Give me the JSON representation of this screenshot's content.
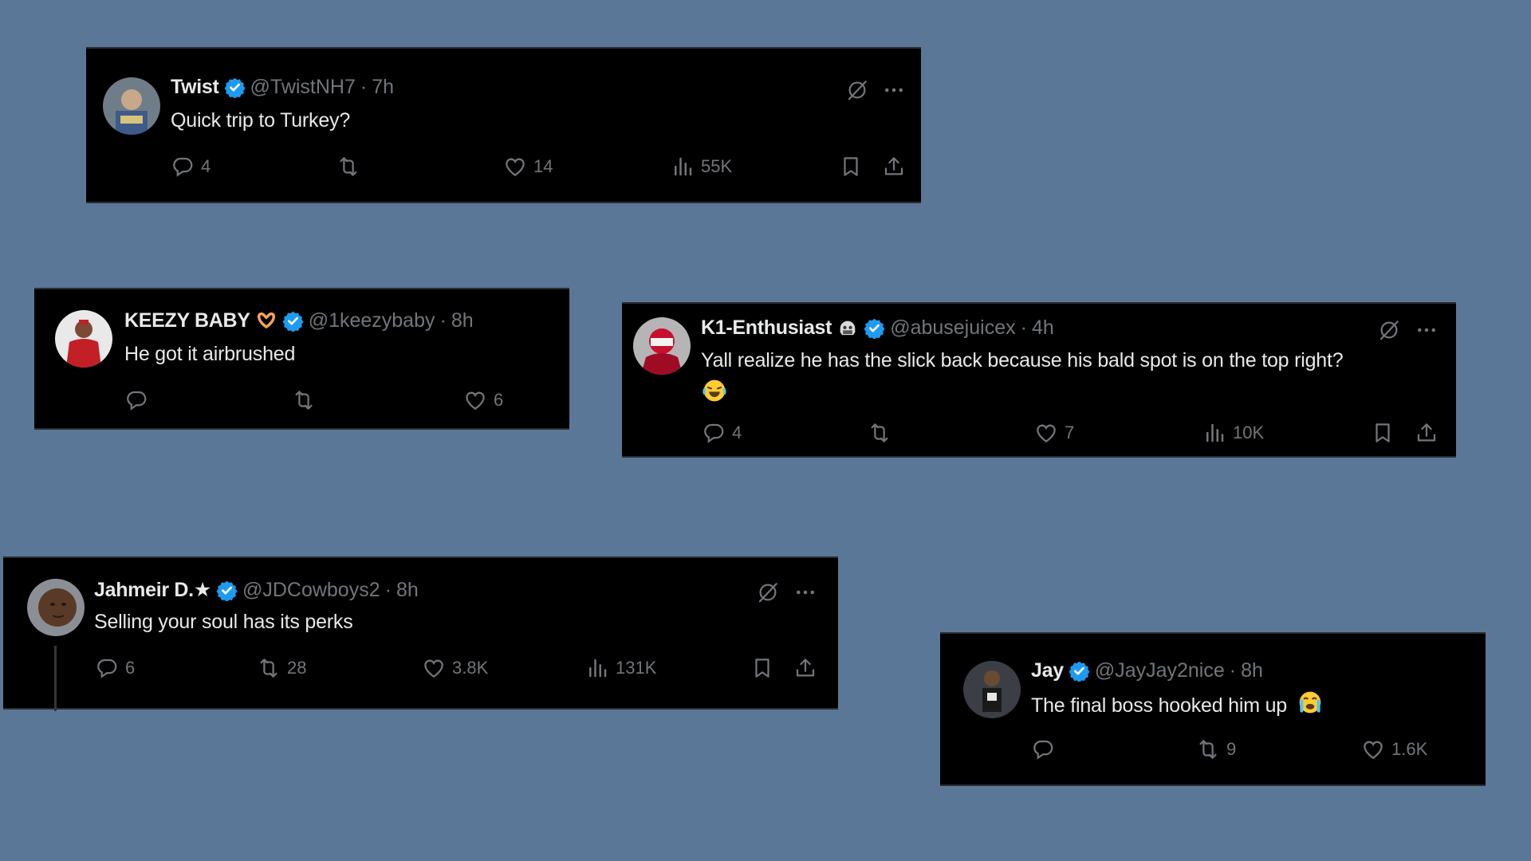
{
  "tweets": [
    {
      "name": "Twist",
      "handle": "@TwistNH7",
      "sep": "·",
      "time": "7h",
      "text": "Quick trip to Turkey?",
      "replies": "4",
      "retweets": "",
      "likes": "14",
      "views": "55K"
    },
    {
      "name": "KEEZY BABY",
      "handle": "@1keezybaby",
      "sep": "·",
      "time": "8h",
      "text": "He got it airbrushed",
      "replies": "",
      "retweets": "",
      "likes": "6"
    },
    {
      "name": "K1-Enthusiast",
      "handle": "@abusejuicex",
      "sep": "·",
      "time": "4h",
      "text": "Yall realize he has the slick back because his bald spot is on the top right?",
      "replies": "4",
      "retweets": "",
      "likes": "7",
      "views": "10K"
    },
    {
      "name": "Jahmeir D.★",
      "handle": "@JDCowboys2",
      "sep": "·",
      "time": "8h",
      "text": "Selling your soul has its perks",
      "replies": "6",
      "retweets": "28",
      "likes": "3.8K",
      "views": "131K"
    },
    {
      "name": "Jay",
      "handle": "@JayJay2nice",
      "sep": "·",
      "time": "8h",
      "text": "The final boss hooked him up",
      "replies": "",
      "retweets": "9",
      "likes": "1.6K"
    }
  ],
  "colors": {
    "background": "#5b7797",
    "card": "#000000",
    "verified": "#1d9bf0",
    "muted": "#71767b"
  },
  "icons": [
    "reply-icon",
    "retweet-icon",
    "like-icon",
    "views-icon",
    "bookmark-icon",
    "share-icon",
    "grok-icon",
    "more-icon",
    "verified-badge-icon",
    "laughing-crying-emoji",
    "crying-emoji",
    "heart-hands-emoji",
    "skull-helmet-emoji"
  ]
}
